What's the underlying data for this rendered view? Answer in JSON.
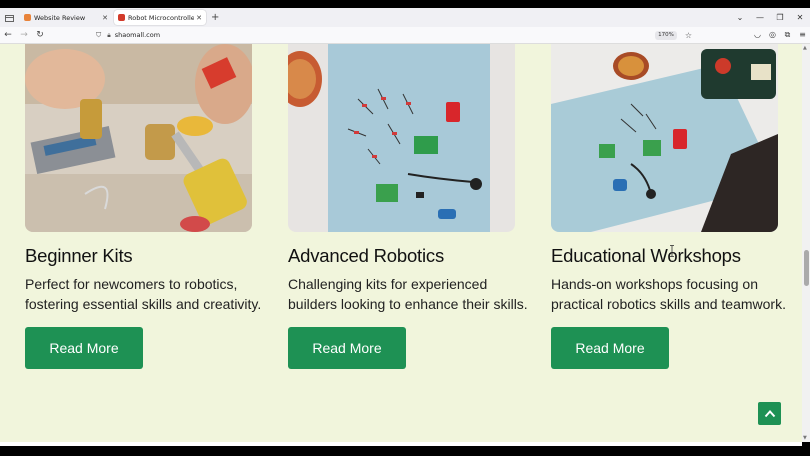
{
  "browser": {
    "tabs": [
      {
        "title": "Website Review",
        "active": false,
        "favicon_color": "#e8833a"
      },
      {
        "title": "Robot Microcontroller Kits Shop",
        "active": true,
        "favicon_color": "#d23a2a"
      }
    ],
    "url": "shaomall.com",
    "zoom": "170%"
  },
  "cards": [
    {
      "title": "Beginner Kits",
      "description": "Perfect for newcomers to robotics, fostering essential skills and creativity.",
      "button": "Read More"
    },
    {
      "title": "Advanced Robotics",
      "description": "Challenging kits for experienced builders looking to enhance their skills.",
      "button": "Read More"
    },
    {
      "title": "Educational Workshops",
      "description": "Hands-on workshops focusing on practical robotics skills and teamwork.",
      "button": "Read More"
    }
  ],
  "colors": {
    "page_background": "#f1f5dc",
    "button": "#1e9154"
  },
  "icons": {
    "back_to_top": "chevron-up-icon"
  }
}
